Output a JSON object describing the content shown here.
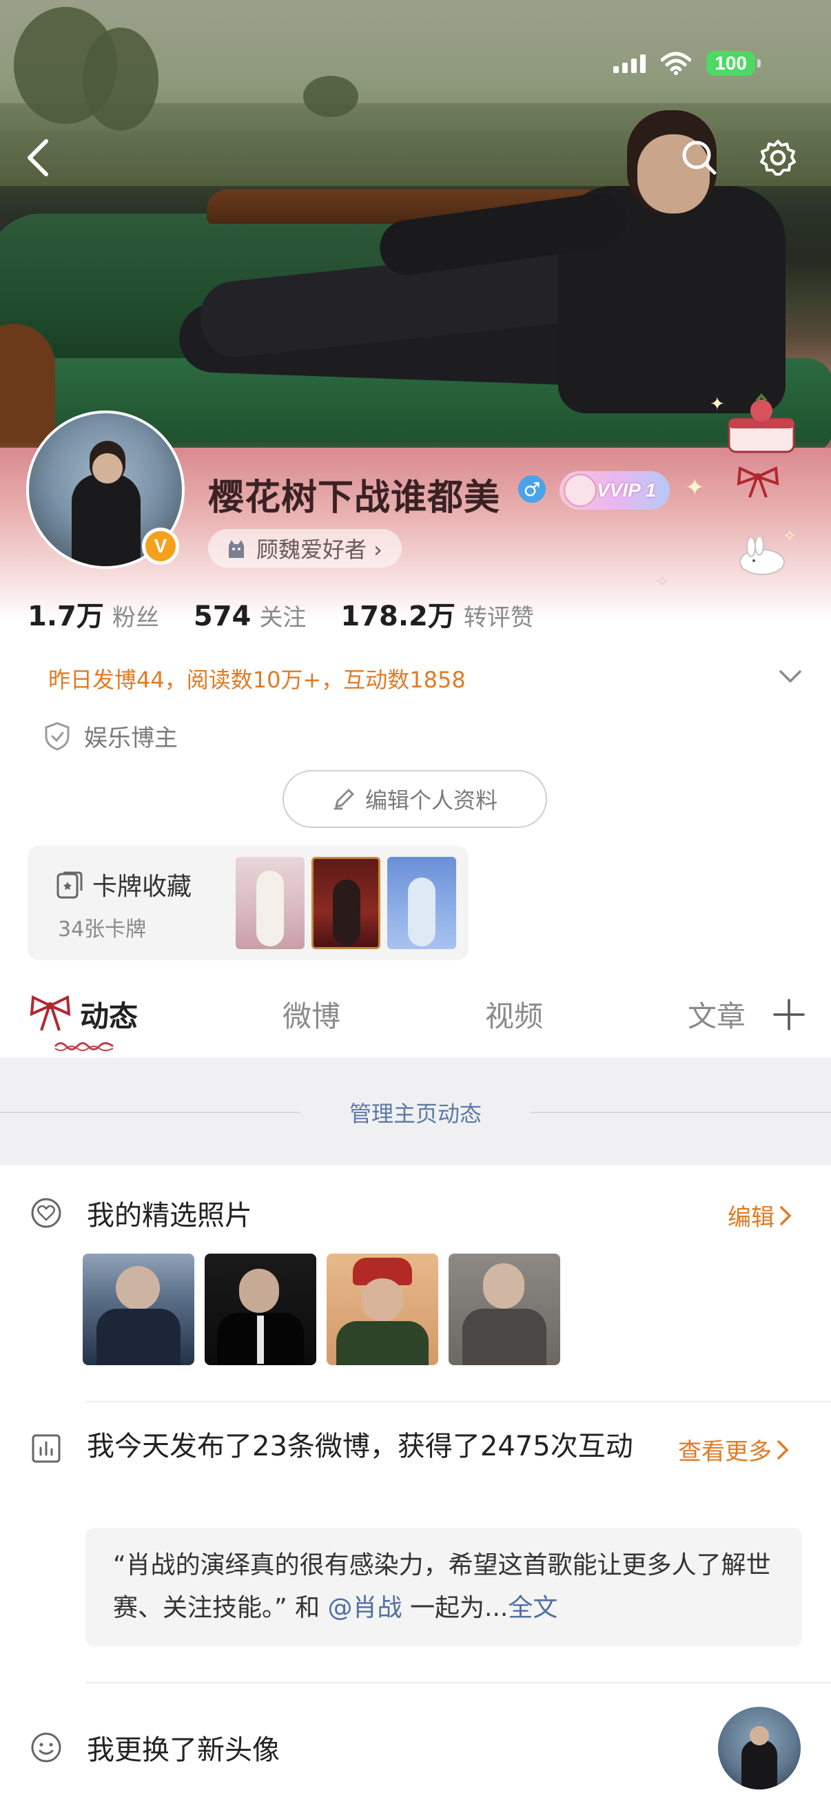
{
  "status_bar": {
    "battery": "100"
  },
  "profile": {
    "username": "樱花树下战谁都美",
    "gender_symbol": "♂",
    "vip_label": "VVIP 1",
    "fan_tag": "顾魏爱好者 ›",
    "verified_badge": "V",
    "stats": [
      {
        "num": "1.7万",
        "label": "粉丝"
      },
      {
        "num": "574",
        "label": "关注"
      },
      {
        "num": "178.2万",
        "label": "转评赞"
      }
    ],
    "yesterday_summary": "昨日发博44，阅读数10万+，互动数1858",
    "category": "娱乐博主",
    "edit_button": "编辑个人资料"
  },
  "cards": {
    "title": "卡牌收藏",
    "subtitle": "34张卡牌"
  },
  "tabs": [
    {
      "label": "动态",
      "active": true
    },
    {
      "label": "微博",
      "active": false
    },
    {
      "label": "视频",
      "active": false
    },
    {
      "label": "文章",
      "active": false
    }
  ],
  "manage_label": "管理主页动态",
  "featured": {
    "title": "我的精选照片",
    "edit_link": "编辑"
  },
  "post_summary": {
    "title": "我今天发布了23条微博，获得了2475次互动",
    "more_link": "查看更多",
    "quote_prefix": "“肖战的演绎真的很有感染力，希望这首歌能让更多人了解世赛、关注技能。” 和 ",
    "quote_mention": "@肖战",
    "quote_suffix": " 一起为...",
    "quote_full": "全文"
  },
  "avatar_update": {
    "title": "我更换了新头像"
  },
  "colors": {
    "accent_orange": "#e07a24",
    "link_blue": "#4f6ea3",
    "battery_green": "#4cd964"
  }
}
